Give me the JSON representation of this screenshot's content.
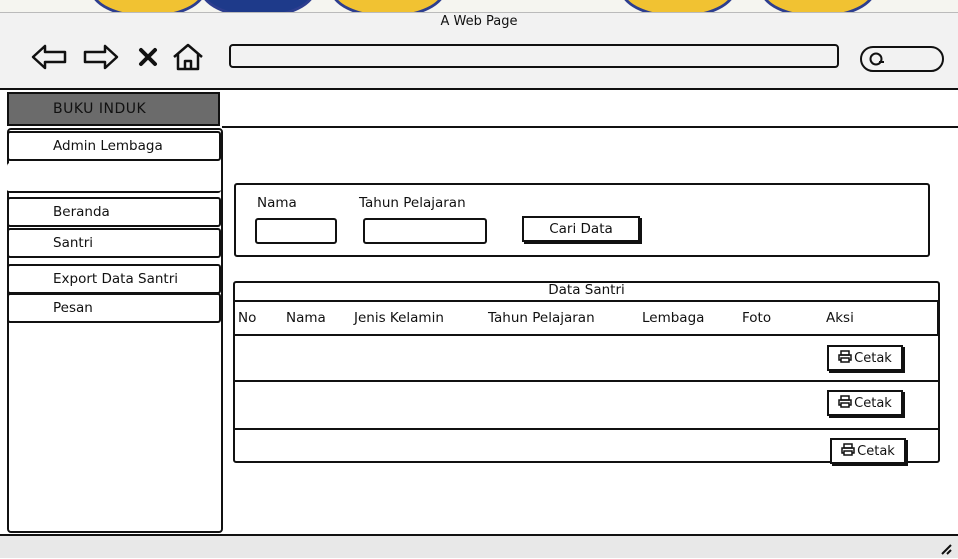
{
  "window": {
    "title": "A Web Page"
  },
  "browser": {
    "url": "",
    "icons": [
      "back-arrow-icon",
      "forward-arrow-icon",
      "close-x-icon",
      "home-icon",
      "search-icon"
    ]
  },
  "app": {
    "brand": "BUKU INDUK"
  },
  "sidebar": {
    "items": [
      {
        "label": "Admin Lembaga"
      },
      {
        "label": ""
      },
      {
        "label": "Beranda"
      },
      {
        "label": "Santri"
      },
      {
        "label": "Export Data Santri"
      },
      {
        "label": "Pesan"
      }
    ]
  },
  "filter": {
    "nama_label": "Nama",
    "nama_value": "",
    "tahun_label": "Tahun Pelajaran",
    "tahun_value": "",
    "button_label": "Cari Data"
  },
  "table": {
    "title": "Data Santri",
    "columns": [
      "No",
      "Nama",
      "Jenis Kelamin",
      "Tahun Pelajaran",
      "Lembaga",
      "Foto",
      "Aksi"
    ],
    "rows": [
      {
        "no": "",
        "nama": "",
        "jenis_kelamin": "",
        "tahun": "",
        "lembaga": "",
        "foto": "",
        "action": "Cetak"
      },
      {
        "no": "",
        "nama": "",
        "jenis_kelamin": "",
        "tahun": "",
        "lembaga": "",
        "foto": "",
        "action": "Cetak"
      },
      {
        "no": "",
        "nama": "",
        "jenis_kelamin": "",
        "tahun": "",
        "lembaga": "",
        "foto": "",
        "action": "Cetak"
      }
    ]
  },
  "colors": {
    "brand_bg": "#6b6b6b",
    "chrome_bg": "#f2f2f2",
    "ink": "#111111"
  }
}
